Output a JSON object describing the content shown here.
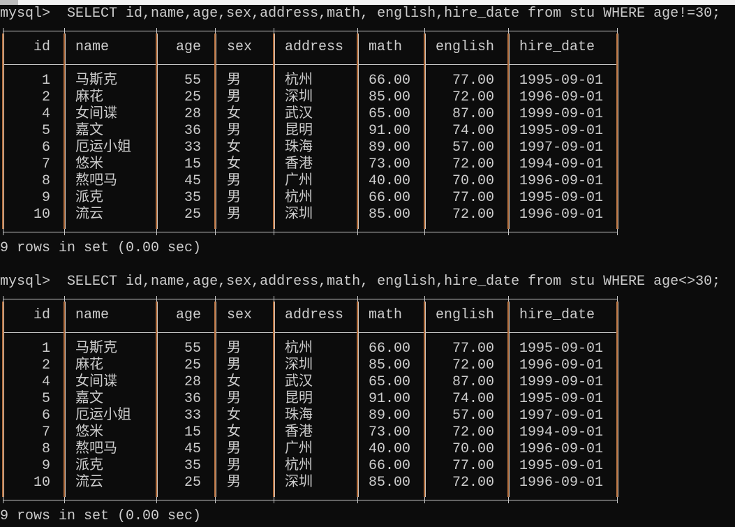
{
  "terminal": {
    "prompt": "mysql>",
    "colors": {
      "background": "#0c0c0c",
      "text": "#cccccc",
      "border": "#b5703f"
    }
  },
  "queries": [
    {
      "command": "SELECT id,name,age,sex,address,math, english,hire_date from stu WHERE age!=30;",
      "footer": "9 rows in set (0.00 sec)"
    },
    {
      "command": "SELECT id,name,age,sex,address,math, english,hire_date from stu WHERE age<>30;",
      "footer": "9 rows in set (0.00 sec)"
    }
  ],
  "columns": [
    "id",
    "name",
    "age",
    "sex",
    "address",
    "math",
    "english",
    "hire_date"
  ],
  "rows": [
    [
      "1",
      "马斯克",
      "55",
      "男",
      "杭州",
      "66.00",
      "77.00",
      "1995-09-01"
    ],
    [
      "2",
      "麻花",
      "25",
      "男",
      "深圳",
      "85.00",
      "72.00",
      "1996-09-01"
    ],
    [
      "4",
      "女间谍",
      "28",
      "女",
      "武汉",
      "65.00",
      "87.00",
      "1999-09-01"
    ],
    [
      "5",
      "嘉文",
      "36",
      "男",
      "昆明",
      "91.00",
      "74.00",
      "1995-09-01"
    ],
    [
      "6",
      "厄运小姐",
      "33",
      "女",
      "珠海",
      "89.00",
      "57.00",
      "1997-09-01"
    ],
    [
      "7",
      "悠米",
      "15",
      "女",
      "香港",
      "73.00",
      "72.00",
      "1994-09-01"
    ],
    [
      "8",
      "熬吧马",
      "45",
      "男",
      "广州",
      "40.00",
      "70.00",
      "1996-09-01"
    ],
    [
      "9",
      "派克",
      "35",
      "男",
      "杭州",
      "66.00",
      "77.00",
      "1995-09-01"
    ],
    [
      "10",
      "流云",
      "25",
      "男",
      "深圳",
      "85.00",
      "72.00",
      "1996-09-01"
    ]
  ]
}
